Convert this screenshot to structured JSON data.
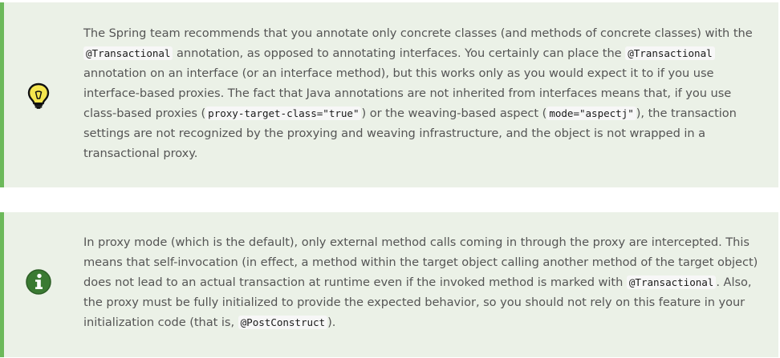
{
  "tip": {
    "icon": "lightbulb-icon",
    "paragraph": {
      "t1": "The Spring team recommends that you annotate only concrete classes (and methods of concrete classes) with the ",
      "c1": "@Transactional",
      "t2": " annotation, as opposed to annotating interfaces. You certainly can place the ",
      "c2": "@Transactional",
      "t3": " annotation on an interface (or an interface method), but this works only as you would expect it to if you use interface-based proxies. The fact that Java annotations are not inherited from interfaces means that, if you use class-based proxies (",
      "c3": "proxy-target-class=\"true\"",
      "t4": ") or the weaving-based aspect (",
      "c4": "mode=\"aspectj\"",
      "t5": "), the transaction settings are not recognized by the proxying and weaving infrastructure, and the object is not wrapped in a transactional proxy."
    }
  },
  "note": {
    "icon": "info-icon",
    "paragraph": {
      "t1": "In proxy mode (which is the default), only external method calls coming in through the proxy are intercepted. This means that self-invocation (in effect, a method within the target object calling another method of the target object) does not lead to an actual transaction at runtime even if the invoked method is marked with ",
      "c1": "@Transactional",
      "t2": ". Also, the proxy must be fully initialized to provide the expected behavior, so you should not rely on this feature in your initialization code (that is, ",
      "c2": "@PostConstruct",
      "t3": ")."
    }
  },
  "colors": {
    "background": "#ebf1e7",
    "accent_border": "#6cb95a",
    "body_text": "#555555",
    "info_icon": "#3a7a32",
    "lightbulb_icon": "#f5e64e"
  }
}
